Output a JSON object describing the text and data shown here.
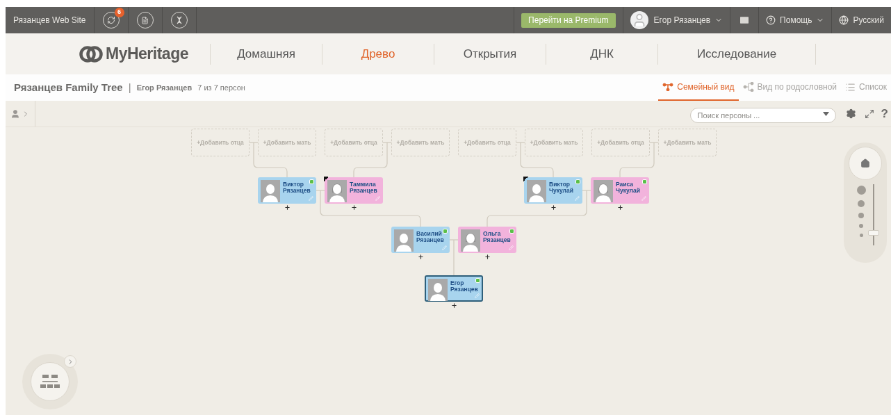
{
  "top_bar": {
    "site": "Рязанцев Web Site",
    "sync_badge": "6",
    "premium": "Перейти на Premium",
    "user": "Егор Рязанцев",
    "help": "Помощь",
    "language": "Русский"
  },
  "nav": {
    "logo": "MyHeritage",
    "items": [
      {
        "label": "Домашняя",
        "selected": false
      },
      {
        "label": "Древо",
        "selected": true
      },
      {
        "label": "Открытия",
        "selected": false
      },
      {
        "label": "ДНК",
        "selected": false
      },
      {
        "label": "Исследование",
        "selected": false
      }
    ]
  },
  "tree_header": {
    "title": "Рязанцев Family Tree",
    "separator": "|",
    "person": "Егор Рязанцев",
    "count": "7 из 7 персон",
    "views": [
      {
        "label": "Семейный вид",
        "kind": "family",
        "selected": true
      },
      {
        "label": "Вид по родословной",
        "kind": "pedigree",
        "selected": false
      },
      {
        "label": "Список",
        "kind": "list",
        "selected": false
      }
    ]
  },
  "toolbar": {
    "search_placeholder": "Поиск персоны ...",
    "help": "?"
  },
  "placeholders": [
    "+Добавить отца",
    "+Добавить мать",
    "+Добавить отца",
    "+Добавить мать",
    "+Добавить отца",
    "+Добавить мать",
    "+Добавить отца",
    "+Добавить мать"
  ],
  "persons": [
    {
      "given": "Виктор",
      "surname": "Рязанцев",
      "kind": "male",
      "deceased": false,
      "has_match": true,
      "selected": false
    },
    {
      "given": "Таммила",
      "surname": "Рязанцев",
      "kind": "female",
      "deceased": true,
      "has_match": false,
      "selected": false
    },
    {
      "given": "Виктор",
      "surname": "Чукулай",
      "kind": "male",
      "deceased": true,
      "has_match": true,
      "selected": false
    },
    {
      "given": "Раиса",
      "surname": "Чукулай",
      "kind": "female",
      "deceased": false,
      "has_match": true,
      "selected": false
    },
    {
      "given": "Василий",
      "surname": "Рязанцев",
      "kind": "male",
      "deceased": false,
      "has_match": true,
      "selected": false
    },
    {
      "given": "Ольга",
      "surname": "Рязанцев",
      "kind": "female",
      "deceased": false,
      "has_match": true,
      "selected": false
    },
    {
      "given": "Егор",
      "surname": "Рязанцев",
      "kind": "male",
      "deceased": false,
      "has_match": true,
      "selected": true
    }
  ],
  "zoom": {
    "level": 0.2
  }
}
